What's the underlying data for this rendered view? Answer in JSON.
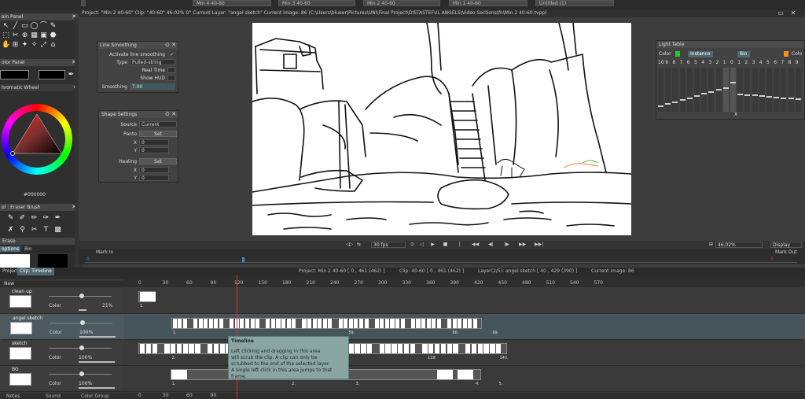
{
  "tabs": [
    {
      "label": "Min 4 40-60"
    },
    {
      "label": "Min 3 40-60"
    },
    {
      "label": "Min 1 40-60"
    },
    {
      "label": "Min 2 40-60"
    },
    {
      "label": "Min 1 40-60"
    },
    {
      "label": "Untitled (1)"
    }
  ],
  "info_bar": "Project: \"Min 2 40-60\"  Clip: \"40-60\"  46.02%  0°  Current Layer: \"angel sketch\"  Current Image: 86 (C:\\Users\\blueer\\Pictures\\UNI\\Final Project\\DISTASTEFUL ANGELS\\Video Sections\\fn\\Min 2 40-60.tvpp)",
  "left": {
    "main_panel": "ain Panel",
    "color_panel": "olor Panel",
    "wheel_mode": "hromatic Wheel",
    "hex": "#000000",
    "tool_panel": "ol : Eraser Brush",
    "erase": "Erase",
    "tabs": [
      "options",
      "Bin"
    ]
  },
  "line_smoothing": {
    "title": "Line Smoothing",
    "activate": "Activate line smoothing",
    "check": "✓",
    "type_label": "Type",
    "type_value": "Pulled-string",
    "real_time": "Real Time",
    "show_hud": "Show HUD",
    "smoothing_label": "Smoothing",
    "smoothing_value": "7.00"
  },
  "shape_settings": {
    "title": "Shape Settings",
    "source_label": "Source",
    "source_value": "Current",
    "panto_label": "Panto",
    "set": "Set",
    "healing_label": "Healing",
    "x": "X",
    "y": "Y",
    "zero": "0"
  },
  "light_table": {
    "title": "Light Table",
    "color": "Color",
    "instance": "Instance",
    "bin": "Bin",
    "color2": "Colo",
    "left_nums": [
      "10",
      "9",
      "8",
      "7",
      "6",
      "5",
      "4",
      "3",
      "2",
      "1"
    ],
    "right_nums": [
      "0",
      "1",
      "2",
      "3",
      "4",
      "5",
      "6",
      "7",
      "8",
      "9"
    ],
    "x_label": "X",
    "green": "#22cc22",
    "orange": "#ff8c1a"
  },
  "playback": {
    "fps": "30 fps",
    "zoom": "46.02%",
    "display": "Display",
    "mark_in": "Mark In",
    "mark_out": "Mark Out",
    "mark_in_value": "0",
    "mark_out_value": "0"
  },
  "timeline": {
    "tabs": [
      "Project",
      "Clip: Timeline"
    ],
    "project_info": "Project: Min 2 40-60 [ 0 , 461  (462) ]",
    "clip_info": "Clip: 40-60 [ 0 , 461 (462) ]",
    "layer_info": "Layer(2/5): angel sketch [ 40 , 429  (390) ]",
    "current_image": "Current image: 86",
    "new_label": "New",
    "ruler": [
      "0",
      "30",
      "60",
      "90",
      "120",
      "150",
      "180",
      "210",
      "240",
      "270",
      "300",
      "330",
      "360",
      "390",
      "420",
      "450",
      "480",
      "510",
      "540",
      "570"
    ],
    "ruler_bottom": [
      "0",
      "30",
      "60",
      "90"
    ],
    "layers": [
      {
        "name": "clean up",
        "color": "Color",
        "opacity": "21%",
        "opacity_value": 0.21,
        "labels": [
          "1."
        ]
      },
      {
        "name": "angel sketch",
        "color": "Color",
        "opacity": "100%",
        "opacity_value": 1,
        "labels": [
          "1.",
          "59.",
          "88.",
          "99."
        ]
      },
      {
        "name": "sketch",
        "color": "Color",
        "opacity": "100%",
        "opacity_value": 1,
        "labels": [
          "2.",
          "84.",
          "118.",
          "140."
        ]
      },
      {
        "name": "BG",
        "color": "Color",
        "opacity": "100%",
        "opacity_value": 1,
        "labels": [
          "1.",
          "2.",
          "3.",
          "4.",
          "5."
        ]
      }
    ],
    "bottom_tabs": [
      "Notes",
      "Sound",
      "Color Group"
    ]
  },
  "tooltip": {
    "title": "Timeline",
    "line1": "Left clicking and dragging in this area",
    "line2": "will scrub the clip. A clip can only be",
    "line3": "scrubbed to the end of the selected layer.",
    "line4": "A single left click in this area jumps to that frame."
  }
}
